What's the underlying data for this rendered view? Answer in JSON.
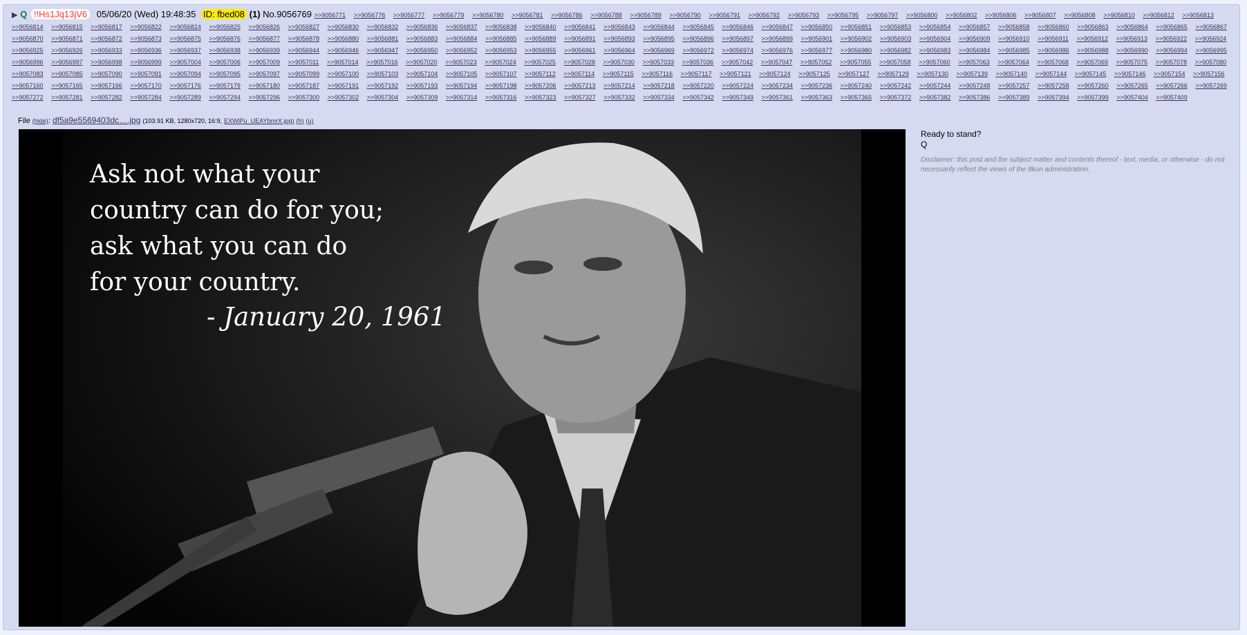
{
  "post": {
    "arrow": "▶",
    "name": "Q",
    "tripcode": "!!Hs1Jq13jV6",
    "date": "05/06/20 (Wed) 19:48:35",
    "id_label": "ID: fbed08",
    "reply_count": "(1)",
    "number": "No.9056769",
    "backlinks": [
      ">>9056771",
      ">>9056776",
      ">>9056777",
      ">>9056779",
      ">>9056780",
      ">>9056781",
      ">>9056786",
      ">>9056788",
      ">>9056789",
      ">>9056790",
      ">>9056791",
      ">>9056792",
      ">>9056793",
      ">>9056795",
      ">>9056797",
      ">>9056800",
      ">>9056802",
      ">>9056806",
      ">>9056807",
      ">>9056808",
      ">>9056810",
      ">>9056812",
      ">>9056813",
      ">>9056814",
      ">>9056815",
      ">>9056817",
      ">>9056822",
      ">>9056824",
      ">>9056825",
      ">>9056826",
      ">>9056827",
      ">>9056830",
      ">>9056832",
      ">>9056836",
      ">>9056837",
      ">>9056838",
      ">>9056840",
      ">>9056841",
      ">>9056843",
      ">>9056844",
      ">>9056845",
      ">>9056846",
      ">>9056847",
      ">>9056850",
      ">>9056851",
      ">>9056853",
      ">>9056854",
      ">>9056857",
      ">>9056858",
      ">>9056860",
      ">>9056863",
      ">>9056864",
      ">>9056865",
      ">>9056867",
      ">>9056870",
      ">>9056871",
      ">>9056872",
      ">>9056873",
      ">>9056875",
      ">>9056876",
      ">>9056877",
      ">>9056878",
      ">>9056880",
      ">>9056881",
      ">>9056883",
      ">>9056884",
      ">>9056885",
      ">>9056889",
      ">>9056891",
      ">>9056893",
      ">>9056895",
      ">>9056896",
      ">>9056897",
      ">>9056899",
      ">>9056901",
      ">>9056902",
      ">>9056903",
      ">>9056904",
      ">>9056909",
      ">>9056910",
      ">>9056911",
      ">>9056912",
      ">>9056913",
      ">>9056922",
      ">>9056924",
      ">>9056925",
      ">>9056926",
      ">>9056933",
      ">>9056936",
      ">>9056937",
      ">>9056938",
      ">>9056939",
      ">>9056944",
      ">>9056946",
      ">>9056947",
      ">>9056950",
      ">>9056952",
      ">>9056953",
      ">>9056955",
      ">>9056961",
      ">>9056964",
      ">>9056969",
      ">>9056972",
      ">>9056974",
      ">>9056976",
      ">>9056977",
      ">>9056980",
      ">>9056982",
      ">>9056983",
      ">>9056984",
      ">>9056985",
      ">>9056986",
      ">>9056988",
      ">>9056990",
      ">>9056994",
      ">>9056995",
      ">>9056996",
      ">>9056997",
      ">>9056998",
      ">>9056999",
      ">>9057004",
      ">>9057006",
      ">>9057009",
      ">>9057011",
      ">>9057014",
      ">>9057016",
      ">>9057020",
      ">>9057023",
      ">>9057024",
      ">>9057025",
      ">>9057028",
      ">>9057030",
      ">>9057033",
      ">>9057036",
      ">>9057042",
      ">>9057047",
      ">>9057052",
      ">>9057055",
      ">>9057058",
      ">>9057060",
      ">>9057063",
      ">>9057064",
      ">>9057068",
      ">>9057069",
      ">>9057075",
      ">>9057078",
      ">>9057080",
      ">>9057083",
      ">>9057085",
      ">>9057090",
      ">>9057091",
      ">>9057094",
      ">>9057095",
      ">>9057097",
      ">>9057099",
      ">>9057100",
      ">>9057103",
      ">>9057104",
      ">>9057105",
      ">>9057107",
      ">>9057112",
      ">>9057114",
      ">>9057115",
      ">>9057116",
      ">>9057117",
      ">>9057121",
      ">>9057124",
      ">>9057125",
      ">>9057127",
      ">>9057129",
      ">>9057130",
      ">>9057139",
      ">>9057140",
      ">>9057144",
      ">>9057145",
      ">>9057146",
      ">>9057154",
      ">>9057156",
      ">>9057160",
      ">>9057165",
      ">>9057166",
      ">>9057170",
      ">>9057176",
      ">>9057179",
      ">>9057180",
      ">>9057187",
      ">>9057191",
      ">>9057192",
      ">>9057193",
      ">>9057194",
      ">>9057198",
      ">>9057206",
      ">>9057213",
      ">>9057214",
      ">>9057218",
      ">>9057220",
      ">>9057224",
      ">>9057234",
      ">>9057236",
      ">>9057240",
      ">>9057242",
      ">>9057244",
      ">>9057248",
      ">>9057257",
      ">>9057258",
      ">>9057260",
      ">>9057265",
      ">>9057266",
      ">>9057269",
      ">>9057272",
      ">>9057281",
      ">>9057282",
      ">>9057284",
      ">>9057289",
      ">>9057294",
      ">>9057296",
      ">>9057300",
      ">>9057302",
      ">>9057304",
      ">>9057309",
      ">>9057314",
      ">>9057316",
      ">>9057323",
      ">>9057327",
      ">>9057332",
      ">>9057334",
      ">>9057342",
      ">>9057349",
      ">>9057361",
      ">>9057363",
      ">>9057365",
      ">>9057372",
      ">>9057382",
      ">>9057386",
      ">>9057389",
      ">>9057394",
      ">>9057399",
      ">>9057404",
      ">>9057409"
    ]
  },
  "file": {
    "label": "File",
    "hide": "(hide)",
    "filename": "df5a9e5569403dc….jpg",
    "meta": "(103.91 KB, 1280x720, 16:9,",
    "orig_name": "EXWlPu_UEAYbmrX.jpg)",
    "h": "(h)",
    "u": "(u)"
  },
  "image": {
    "quote_lines": [
      "Ask not what your",
      "country can do for you;",
      "ask what you can do",
      "for your country."
    ],
    "date": "- January 20, 1961"
  },
  "body": {
    "line1": "Ready to stand?",
    "line2": "Q",
    "disclaimer": "Disclaimer: this post and the subject matter and contents thereof - text, media, or otherwise - do not necessarily reflect the views of the 8kun administration."
  }
}
